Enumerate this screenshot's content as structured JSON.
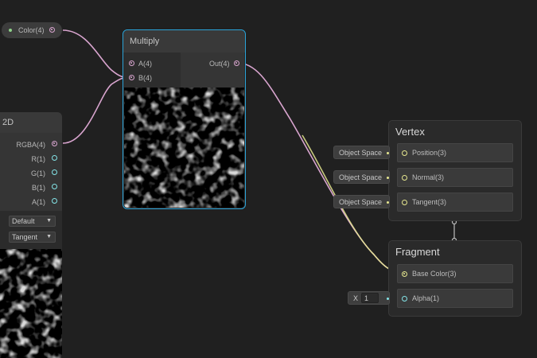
{
  "property_node": {
    "label": "Color(4)"
  },
  "multiply_node": {
    "title": "Multiply",
    "inputs": [
      "A(4)",
      "B(4)"
    ],
    "output": "Out(4)"
  },
  "sample_node": {
    "title_fragment": "2D",
    "outputs": [
      "RGBA(4)",
      "R(1)",
      "G(1)",
      "B(1)",
      "A(1)"
    ],
    "type_dropdown": "Default",
    "space_dropdown": "Tangent"
  },
  "vertex_context": {
    "title": "Vertex",
    "blocks": [
      {
        "label": "Position(3)",
        "input": "Object Space"
      },
      {
        "label": "Normal(3)",
        "input": "Object Space"
      },
      {
        "label": "Tangent(3)",
        "input": "Object Space"
      }
    ]
  },
  "fragment_context": {
    "title": "Fragment",
    "blocks": [
      {
        "label": "Base Color(3)"
      },
      {
        "label": "Alpha(1)"
      }
    ],
    "alpha_input": {
      "axis": "X",
      "value": "1"
    }
  },
  "colors": {
    "background": "#202020",
    "vector4_port": "#d9a5cf",
    "float_port": "#84e4e7",
    "vector3_port": "#e6e78f",
    "selection": "#2aa3d8"
  },
  "icons": [
    "noise-preview",
    "dropdown-caret"
  ]
}
